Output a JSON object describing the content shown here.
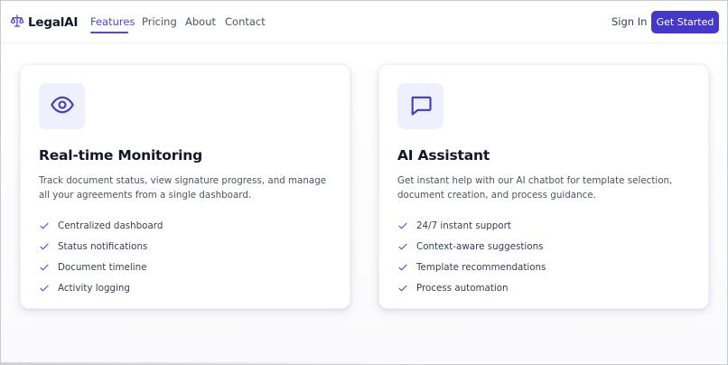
{
  "brand": {
    "name": "LegalAI",
    "icon": "scale-icon",
    "accent": "#4f46e5"
  },
  "nav": {
    "links": [
      {
        "label": "Features",
        "active": true
      },
      {
        "label": "Pricing",
        "active": false
      },
      {
        "label": "About",
        "active": false
      },
      {
        "label": "Contact",
        "active": false
      }
    ],
    "sign_in": "Sign In",
    "cta": "Get Started"
  },
  "cards": [
    {
      "icon": "eye-icon",
      "title": "Real-time Monitoring",
      "description": "Track document status, view signature progress, and manage all your agreements from a single dashboard.",
      "features": [
        "Centralized dashboard",
        "Status notifications",
        "Document timeline",
        "Activity logging"
      ]
    },
    {
      "icon": "chat-bubble-icon",
      "title": "AI Assistant",
      "description": "Get instant help with our AI chatbot for template selection, document creation, and process guidance.",
      "features": [
        "24/7 instant support",
        "Context-aware suggestions",
        "Template recommendations",
        "Process automation"
      ]
    }
  ]
}
